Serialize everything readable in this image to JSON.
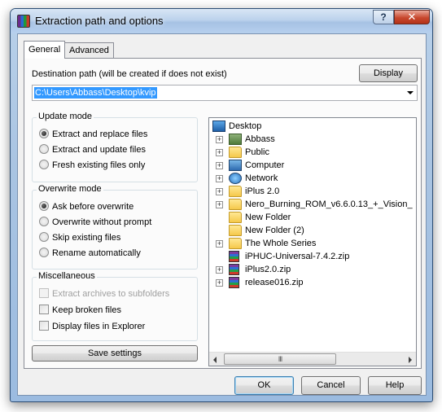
{
  "window": {
    "title": "Extraction path and options",
    "help_glyph": "?",
    "close_glyph": "✕"
  },
  "tabs": [
    {
      "label": "General",
      "active": true
    },
    {
      "label": "Advanced",
      "active": false
    }
  ],
  "destination": {
    "label": "Destination path (will be created if does not exist)",
    "value": "C:\\Users\\Abbass\\Desktop\\kvip",
    "display_button": "Display"
  },
  "update_mode": {
    "title": "Update mode",
    "options": [
      {
        "label": "Extract and replace files",
        "checked": true
      },
      {
        "label": "Extract and update files",
        "checked": false
      },
      {
        "label": "Fresh existing files only",
        "checked": false
      }
    ]
  },
  "overwrite_mode": {
    "title": "Overwrite mode",
    "options": [
      {
        "label": "Ask before overwrite",
        "checked": true
      },
      {
        "label": "Overwrite without prompt",
        "checked": false
      },
      {
        "label": "Skip existing files",
        "checked": false
      },
      {
        "label": "Rename automatically",
        "checked": false
      }
    ]
  },
  "misc": {
    "title": "Miscellaneous",
    "options": [
      {
        "label": "Extract archives to subfolders",
        "checked": false,
        "disabled": true
      },
      {
        "label": "Keep broken files",
        "checked": false,
        "disabled": false
      },
      {
        "label": "Display files in Explorer",
        "checked": false,
        "disabled": false
      }
    ]
  },
  "save_settings": "Save settings",
  "tree": {
    "root": "Desktop",
    "items": [
      {
        "label": "Abbass",
        "icon": "user-folder-icon",
        "expander": "+"
      },
      {
        "label": "Public",
        "icon": "folder-icon",
        "expander": "+"
      },
      {
        "label": "Computer",
        "icon": "computer-icon",
        "expander": "+"
      },
      {
        "label": "Network",
        "icon": "network-icon",
        "expander": "+"
      },
      {
        "label": "iPlus 2.0",
        "icon": "folder-icon",
        "expander": "+"
      },
      {
        "label": "Nero_Burning_ROM_v6.6.0.13_+_Vision_",
        "icon": "folder-icon",
        "expander": "+"
      },
      {
        "label": "New Folder",
        "icon": "folder-icon",
        "expander": ""
      },
      {
        "label": "New Folder (2)",
        "icon": "folder-icon",
        "expander": ""
      },
      {
        "label": "The Whole Series",
        "icon": "folder-icon",
        "expander": "+"
      },
      {
        "label": "iPHUC-Universal-7.4.2.zip",
        "icon": "archive-icon",
        "expander": ""
      },
      {
        "label": "iPlus2.0.zip",
        "icon": "archive-icon",
        "expander": "+"
      },
      {
        "label": "release016.zip",
        "icon": "archive-icon",
        "expander": "+"
      }
    ],
    "scroll_grip": "III"
  },
  "buttons": {
    "ok": "OK",
    "cancel": "Cancel",
    "help": "Help"
  }
}
